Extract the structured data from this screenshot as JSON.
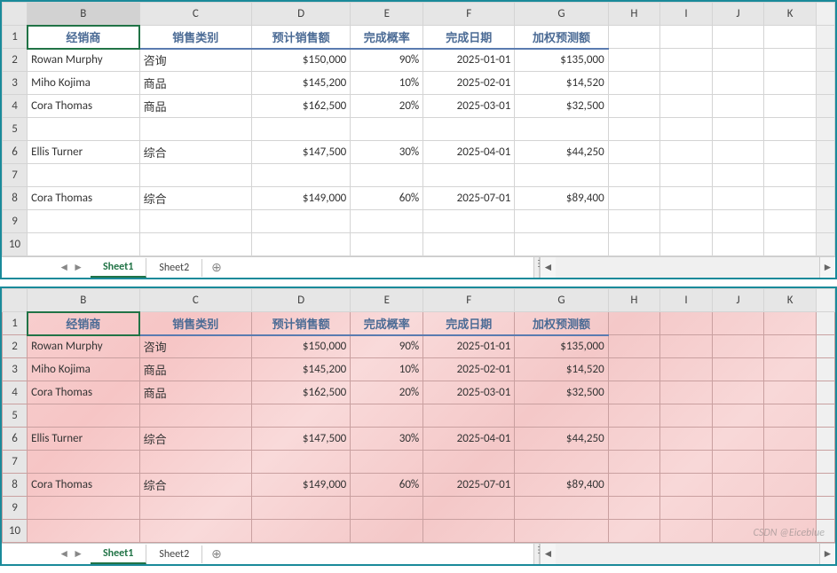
{
  "columns": [
    "B",
    "C",
    "D",
    "E",
    "F",
    "G",
    "H",
    "I",
    "J",
    "K"
  ],
  "active_column": "B",
  "headers": {
    "B": "经销商",
    "C": "销售类别",
    "D": "预计销售额",
    "E": "完成概率",
    "F": "完成日期",
    "G": "加权预测额"
  },
  "rows": [
    {
      "n": 1,
      "type": "header"
    },
    {
      "n": 2,
      "B": "Rowan Murphy",
      "C": "咨询",
      "D": "$150,000",
      "E": "90%",
      "F": "2025-01-01",
      "G": "$135,000"
    },
    {
      "n": 3,
      "B": "Miho Kojima",
      "C": "商品",
      "D": "$145,200",
      "E": "10%",
      "F": "2025-02-01",
      "G": "$14,520"
    },
    {
      "n": 4,
      "B": "Cora Thomas",
      "C": "商品",
      "D": "$162,500",
      "E": "20%",
      "F": "2025-03-01",
      "G": "$32,500"
    },
    {
      "n": 5
    },
    {
      "n": 6,
      "B": "Ellis Turner",
      "C": "综合",
      "D": "$147,500",
      "E": "30%",
      "F": "2025-04-01",
      "G": "$44,250"
    },
    {
      "n": 7
    },
    {
      "n": 8,
      "B": "Cora Thomas",
      "C": "综合",
      "D": "$149,000",
      "E": "60%",
      "F": "2025-07-01",
      "G": "$89,400"
    },
    {
      "n": 9
    },
    {
      "n": 10
    }
  ],
  "tabs": {
    "items": [
      "Sheet1",
      "Sheet2"
    ],
    "active": "Sheet1",
    "add_glyph": "⊕"
  },
  "nav": {
    "prev": "◄",
    "next": "►",
    "first": " ",
    "sep": "⋮"
  },
  "watermark": "CSDN @Eiceblue",
  "chart_data": {
    "type": "table",
    "title": "Sales forecast table (two views: plain background vs pink texture background)",
    "columns": [
      "经销商",
      "销售类别",
      "预计销售额",
      "完成概率",
      "完成日期",
      "加权预测额"
    ],
    "records": [
      {
        "经销商": "Rowan Murphy",
        "销售类别": "咨询",
        "预计销售额": 150000,
        "完成概率": 0.9,
        "完成日期": "2025-01-01",
        "加权预测额": 135000
      },
      {
        "经销商": "Miho Kojima",
        "销售类别": "商品",
        "预计销售额": 145200,
        "完成概率": 0.1,
        "完成日期": "2025-02-01",
        "加权预测额": 14520
      },
      {
        "经销商": "Cora Thomas",
        "销售类别": "商品",
        "预计销售额": 162500,
        "完成概率": 0.2,
        "完成日期": "2025-03-01",
        "加权预测额": 32500
      },
      {
        "经销商": "Ellis Turner",
        "销售类别": "综合",
        "预计销售额": 147500,
        "完成概率": 0.3,
        "完成日期": "2025-04-01",
        "加权预测额": 44250
      },
      {
        "经销商": "Cora Thomas",
        "销售类别": "综合",
        "预计销售额": 149000,
        "完成概率": 0.6,
        "完成日期": "2025-07-01",
        "加权预测额": 89400
      }
    ]
  }
}
